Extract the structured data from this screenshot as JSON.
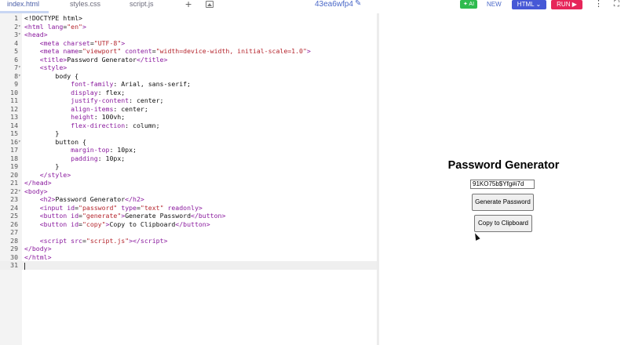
{
  "tabs": [
    {
      "label": "index.html"
    },
    {
      "label": "styles.css"
    },
    {
      "label": "script.js"
    }
  ],
  "header": {
    "project_id": "43ea6wfp4",
    "ai_label": "AI",
    "new_label": "NEW",
    "html_label": "HTML ⌄",
    "run_label": "RUN ▶"
  },
  "editor": {
    "lines": [
      {
        "n": "1",
        "fold": "",
        "html": "<span class='val'>&lt;!DOCTYPE html&gt;</span>"
      },
      {
        "n": "2",
        "fold": "▾",
        "html": "<span class='tag'>&lt;html</span> <span class='attr'>lang</span>=<span class='str'>\"en\"</span><span class='tag'>&gt;</span>"
      },
      {
        "n": "3",
        "fold": "▾",
        "html": "<span class='tag'>&lt;head&gt;</span>"
      },
      {
        "n": "4",
        "fold": "",
        "html": "    <span class='tag'>&lt;meta</span> <span class='attr'>charset</span>=<span class='str'>\"UTF-8\"</span><span class='tag'>&gt;</span>"
      },
      {
        "n": "5",
        "fold": "",
        "html": "    <span class='tag'>&lt;meta</span> <span class='attr'>name</span>=<span class='str'>\"viewport\"</span> <span class='attr'>content</span>=<span class='str'>\"width=device-width, initial-scale=1.0\"</span><span class='tag'>&gt;</span>"
      },
      {
        "n": "6",
        "fold": "",
        "html": "    <span class='tag'>&lt;title&gt;</span>Password Generator<span class='tag'>&lt;/title&gt;</span>"
      },
      {
        "n": "7",
        "fold": "▾",
        "html": "    <span class='tag'>&lt;style&gt;</span>"
      },
      {
        "n": "8",
        "fold": "▾",
        "html": "        body {"
      },
      {
        "n": "9",
        "fold": "",
        "html": "            <span class='prop'>font-family</span>: Arial, sans-serif;"
      },
      {
        "n": "10",
        "fold": "",
        "html": "            <span class='prop'>display</span>: flex;"
      },
      {
        "n": "11",
        "fold": "",
        "html": "            <span class='prop'>justify-content</span>: center;"
      },
      {
        "n": "12",
        "fold": "",
        "html": "            <span class='prop'>align-items</span>: center;"
      },
      {
        "n": "13",
        "fold": "",
        "html": "            <span class='prop'>height</span>: 100vh;"
      },
      {
        "n": "14",
        "fold": "",
        "html": "            <span class='prop'>flex-direction</span>: column;"
      },
      {
        "n": "15",
        "fold": "",
        "html": "        }"
      },
      {
        "n": "16",
        "fold": "▾",
        "html": "        button {"
      },
      {
        "n": "17",
        "fold": "",
        "html": "            <span class='prop'>margin-top</span>: 10px;"
      },
      {
        "n": "18",
        "fold": "",
        "html": "            <span class='prop'>padding</span>: 10px;"
      },
      {
        "n": "19",
        "fold": "",
        "html": "        }"
      },
      {
        "n": "20",
        "fold": "",
        "html": "    <span class='tag'>&lt;/style&gt;</span>"
      },
      {
        "n": "21",
        "fold": "",
        "html": "<span class='tag'>&lt;/head&gt;</span>"
      },
      {
        "n": "22",
        "fold": "▾",
        "html": "<span class='tag'>&lt;body&gt;</span>"
      },
      {
        "n": "23",
        "fold": "",
        "html": "    <span class='tag'>&lt;h2&gt;</span>Password Generator<span class='tag'>&lt;/h2&gt;</span>"
      },
      {
        "n": "24",
        "fold": "",
        "html": "    <span class='tag'>&lt;input</span> <span class='attr'>id</span>=<span class='str'>\"password\"</span> <span class='attr'>type</span>=<span class='str'>\"text\"</span> <span class='attr'>readonly</span><span class='tag'>&gt;</span>"
      },
      {
        "n": "25",
        "fold": "",
        "html": "    <span class='tag'>&lt;button</span> <span class='attr'>id</span>=<span class='str'>\"generate\"</span><span class='tag'>&gt;</span>Generate Password<span class='tag'>&lt;/button&gt;</span>"
      },
      {
        "n": "26",
        "fold": "",
        "html": "    <span class='tag'>&lt;button</span> <span class='attr'>id</span>=<span class='str'>\"copy\"</span><span class='tag'>&gt;</span>Copy to Clipboard<span class='tag'>&lt;/button&gt;</span>"
      },
      {
        "n": "27",
        "fold": "",
        "html": ""
      },
      {
        "n": "28",
        "fold": "",
        "html": "    <span class='tag'>&lt;script</span> <span class='attr'>src</span>=<span class='str'>\"script.js\"</span><span class='tag'>&gt;&lt;/script&gt;</span>"
      },
      {
        "n": "29",
        "fold": "",
        "html": "<span class='tag'>&lt;/body&gt;</span>"
      },
      {
        "n": "30",
        "fold": "",
        "html": "<span class='tag'>&lt;/html&gt;</span>"
      },
      {
        "n": "31",
        "fold": "",
        "html": ""
      }
    ]
  },
  "preview": {
    "title": "Password Generator",
    "password_value": "91KO75b$Yfg#i7d",
    "generate_label": "Generate Password",
    "copy_label": "Copy to Clipboard"
  },
  "colors": {
    "ai_button": "#2fbb4e",
    "html_button": "#4658d6",
    "run_button": "#e6265a",
    "tag": "#8a1a9e",
    "string": "#b5262e"
  }
}
